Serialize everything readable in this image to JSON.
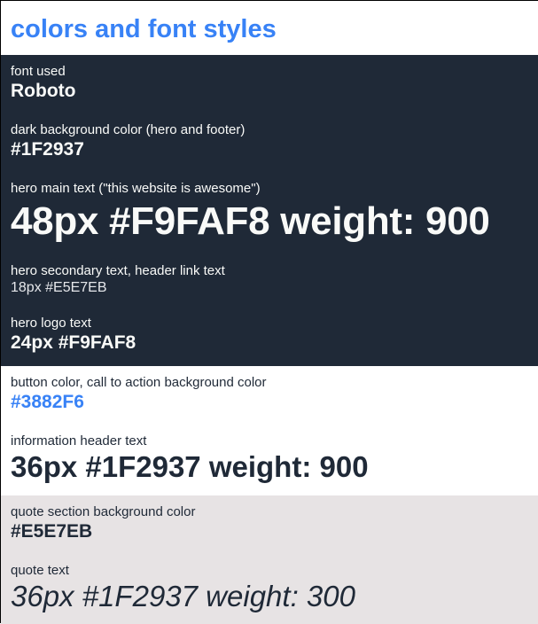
{
  "title": "colors and font styles",
  "colors": {
    "accent": "#3882F6",
    "dark_bg": "#1F2937",
    "hero_text": "#F9FAF8",
    "secondary_text": "#E5E7EB",
    "quote_bg": "#E5E7EB"
  },
  "sections": {
    "font": {
      "label": "font used",
      "value": "Roboto"
    },
    "dark_bg": {
      "label": "dark background color (hero and footer)",
      "value": "#1F2937"
    },
    "hero_main": {
      "label": "hero main text (\"this website is awesome\")",
      "value": "48px #F9FAF8 weight: 900"
    },
    "hero_secondary": {
      "label": "hero secondary text, header link text",
      "value": "18px #E5E7EB"
    },
    "hero_logo": {
      "label": "hero logo text",
      "value": "24px #F9FAF8"
    },
    "button_color": {
      "label": "button color, call to action background color",
      "value": "#3882F6"
    },
    "info_header": {
      "label": "information header text",
      "value": "36px #1F2937 weight: 900"
    },
    "quote_bg": {
      "label": "quote section background color",
      "value": "#E5E7EB"
    },
    "quote_text": {
      "label": "quote text",
      "value": "36px #1F2937 weight: 300"
    }
  }
}
